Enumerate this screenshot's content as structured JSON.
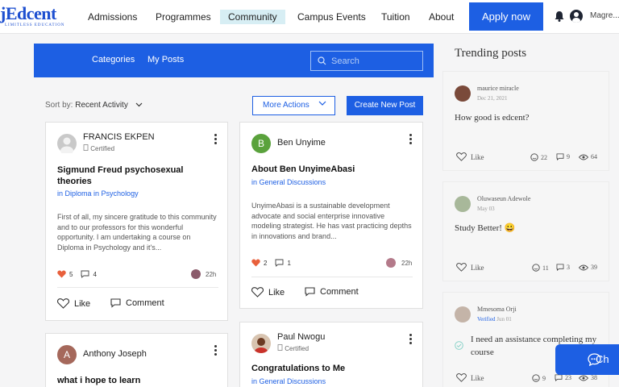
{
  "brand": {
    "name": "jEdcent",
    "tagline": "LIMITLESS EDUCATION",
    "color": "#1d4fd0"
  },
  "nav": {
    "links": [
      "Admissions",
      "Programmes",
      "Community",
      "Campus Events",
      "Tuition",
      "About"
    ],
    "active": "Community",
    "apply_label": "Apply now",
    "username": "Magre..."
  },
  "subnav": {
    "categories": "Categories",
    "my_posts": "My Posts",
    "search_placeholder": "Search"
  },
  "toolbar": {
    "sort_prefix": "Sort by:",
    "sort_value": "Recent Activity",
    "more_actions": "More Actions",
    "create_post": "Create New Post"
  },
  "posts": [
    {
      "author": "FRANCIS EKPEN",
      "badge": "Certified",
      "title": "Sigmund Freud psychosexual theories",
      "category_prefix": "in",
      "category": "Diploma in Psychology",
      "excerpt": "First of all, my sincere gratitude to this community and to our professors for this wonderful opportunity. I am undertaking a course on Diploma in Psychology and it's...",
      "likes": "5",
      "comments": "4",
      "time": "22h",
      "like_label": "Like",
      "comment_label": "Comment"
    },
    {
      "author": "Ben Unyime",
      "avatar_letter": "B",
      "title": "About Ben UnyimeAbasi",
      "category_prefix": "in",
      "category": "General Discussions",
      "excerpt": "UnyimeAbasi is a sustainable development advocate and social enterprise innovative modeling strategist. He has vast practicing depths in innovations and brand...",
      "likes": "2",
      "comments": "1",
      "time": "22h",
      "like_label": "Like",
      "comment_label": "Comment"
    },
    {
      "author": "Anthony Joseph",
      "avatar_letter": "A",
      "title": "what i hope to learn"
    },
    {
      "author": "Paul Nwogu",
      "badge": "Certified",
      "title": "Congratulations to Me",
      "category_prefix": "in",
      "category": "General Discussions"
    }
  ],
  "trending": {
    "title": "Trending posts",
    "like_label": "Like",
    "items": [
      {
        "author": "maurice miracle",
        "date": "Dec 21, 2021",
        "text": "How good is edcent?",
        "reactions": "22",
        "comments": "9",
        "views": "64"
      },
      {
        "author": "Oluwaseun Adewole",
        "date": "May 03",
        "text": "Study Better! 😀",
        "reactions": "11",
        "comments": "3",
        "views": "39"
      },
      {
        "author": "Mmesoma Orji",
        "verified": "Verified",
        "date": "Jun 01",
        "text": "I need an assistance completing my course",
        "reactions": "9",
        "comments": "23",
        "views": "38"
      }
    ]
  },
  "chat": {
    "label": "Ch"
  }
}
